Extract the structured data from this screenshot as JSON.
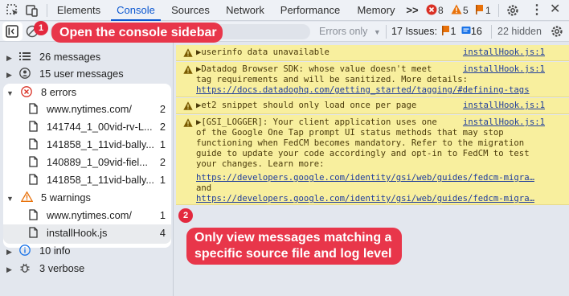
{
  "tabs": {
    "elements": "Elements",
    "console": "Console",
    "sources": "Sources",
    "network": "Network",
    "performance": "Performance",
    "memory": "Memory",
    "more": ">>"
  },
  "counts": {
    "errors": "8",
    "warnings": "5",
    "issues": "1"
  },
  "toolbar": {
    "filter_placeholder": "",
    "levels_label": "Errors only",
    "issues_label": "17 Issues:",
    "issues_flag": "1",
    "issues_info": "16",
    "hidden_label": "22 hidden"
  },
  "sidebar": {
    "messages": "26 messages",
    "user_messages": "15 user messages",
    "errors": {
      "label": "8 errors",
      "items": [
        {
          "label": "www.nytimes.com/",
          "count": "2"
        },
        {
          "label": "141744_1_00vid-rv-L...",
          "count": "2"
        },
        {
          "label": "141858_1_11vid-bally...",
          "count": "1"
        },
        {
          "label": "140889_1_09vid-fiel...",
          "count": "2"
        },
        {
          "label": "141858_1_11vid-bally...",
          "count": "1"
        }
      ]
    },
    "warnings": {
      "label": "5 warnings",
      "items": [
        {
          "label": "www.nytimes.com/",
          "count": "1"
        },
        {
          "label": "installHook.js",
          "count": "4"
        }
      ]
    },
    "info": "10 info",
    "verbose": "3 verbose"
  },
  "messages": [
    {
      "text": "▶userinfo data unavailable",
      "source": "installHook.js:1"
    },
    {
      "text": "▶Datadog Browser SDK: whose value doesn't meet\ntag requirements and will be sanitized. More details:",
      "source": "installHook.js:1",
      "link": "https://docs.datadoghq.com/getting_started/tagging/#defining-tags"
    },
    {
      "text": "▶et2 snippet should only load once per page",
      "source": "installHook.js:1"
    },
    {
      "text": "▶[GSI_LOGGER]: Your client application uses one\nof the Google One Tap prompt UI status methods that may stop\nfunctioning when FedCM becomes mandatory. Refer to the migration\nguide to update your code accordingly and opt-in to FedCM to test\nyour changes. Learn more:",
      "source": "installHook.js:1",
      "link": "https://developers.google.com/identity/gsi/web/guides/fedcm-migra…",
      "and": "and",
      "link2": "https://developers.google.com/identity/gsi/web/guides/fedcm-migra…"
    }
  ],
  "callouts": {
    "one": {
      "badge": "1",
      "text": "Open the console sidebar"
    },
    "two": {
      "badge": "2",
      "text": "Only view messages matching a\nspecific source file and log level"
    }
  },
  "colors": {
    "accent": "#0b57d0",
    "callout": "#e8364a",
    "warning_bg": "#f8ef9e",
    "error": "#d93025",
    "warning": "#e8710a"
  }
}
